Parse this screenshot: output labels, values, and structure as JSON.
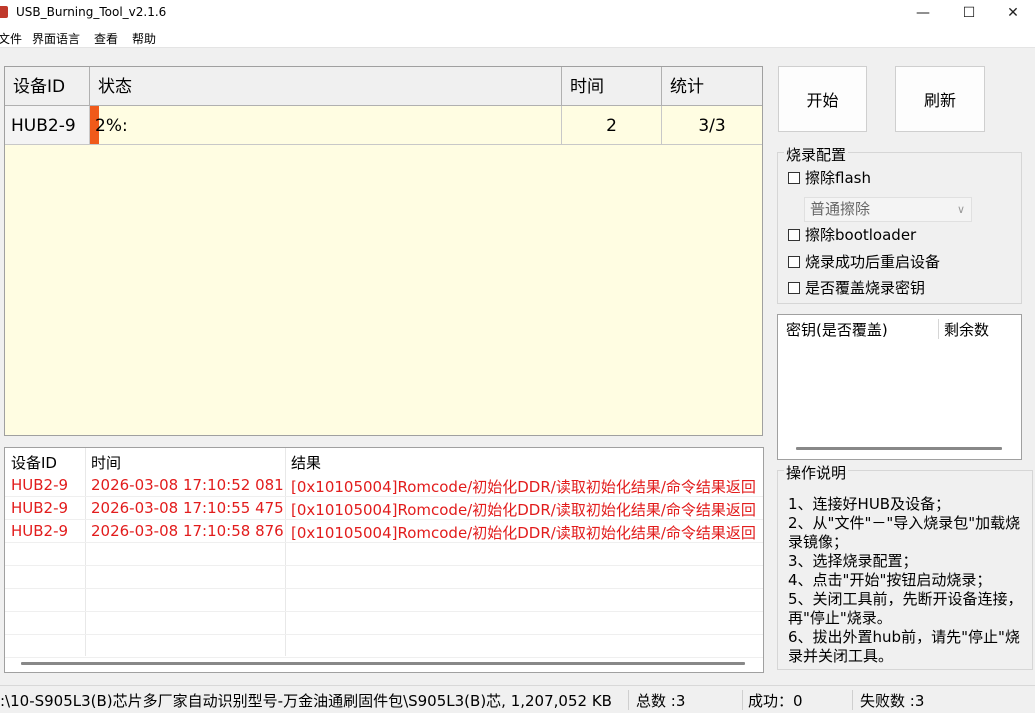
{
  "window": {
    "title": "USB_Burning_Tool_v2.1.6",
    "minimize_glyph": "—",
    "maximize_glyph": "☐",
    "close_glyph": "✕"
  },
  "menu": [
    "文件",
    "界面语言",
    "查看",
    "帮助"
  ],
  "device_grid": {
    "headers": [
      "设备ID",
      "状态",
      "时间",
      "统计"
    ],
    "rows": [
      {
        "id": "HUB2-9",
        "status": "2%:",
        "progress_pct": 2,
        "time": "2",
        "stats": "3/3"
      }
    ]
  },
  "buttons": {
    "start": "开始",
    "refresh": "刷新"
  },
  "burn_config": {
    "title": "烧录配置",
    "erase_flash": "擦除flash",
    "erase_mode": "普通擦除",
    "erase_bootloader": "擦除bootloader",
    "reboot_after": "烧录成功后重启设备",
    "overwrite_key": "是否覆盖烧录密钥"
  },
  "key_list": {
    "col_key": "密钥(是否覆盖)",
    "col_remaining": "剩余数"
  },
  "log": {
    "headers": [
      "设备ID",
      "时间",
      "结果"
    ],
    "rows": [
      {
        "id": "HUB2-9",
        "time": "2026-03-08 17:10:52 081",
        "result": "[0x10105004]Romcode/初始化DDR/读取初始化结果/命令结果返回"
      },
      {
        "id": "HUB2-9",
        "time": "2026-03-08 17:10:55 475",
        "result": "[0x10105004]Romcode/初始化DDR/读取初始化结果/命令结果返回"
      },
      {
        "id": "HUB2-9",
        "time": "2026-03-08 17:10:58 876",
        "result": "[0x10105004]Romcode/初始化DDR/读取初始化结果/命令结果返回"
      }
    ]
  },
  "instructions": {
    "title": "操作说明",
    "text": "1、连接好HUB及设备；\n2、从\"文件\"－\"导入烧录包\"加载烧录镜像；\n3、选择烧录配置；\n4、点击\"开始\"按钮启动烧录；\n5、关闭工具前，先断开设备连接，再\"停止\"烧录。\n6、拔出外置hub前，请先\"停止\"烧录并关闭工具。"
  },
  "status_bar": {
    "path": ":\\10-S905L3(B)芯片多厂家自动识别型号-万金油通刷固件包\\S905L3(B)芯, 1,207,052 KB",
    "total": "总数 :3",
    "success": "成功：0",
    "failed": "失败数 :3"
  },
  "colors": {
    "grid_bg": "#fffde2",
    "progress": "#f05a1a",
    "log_error": "#e21c1c"
  }
}
